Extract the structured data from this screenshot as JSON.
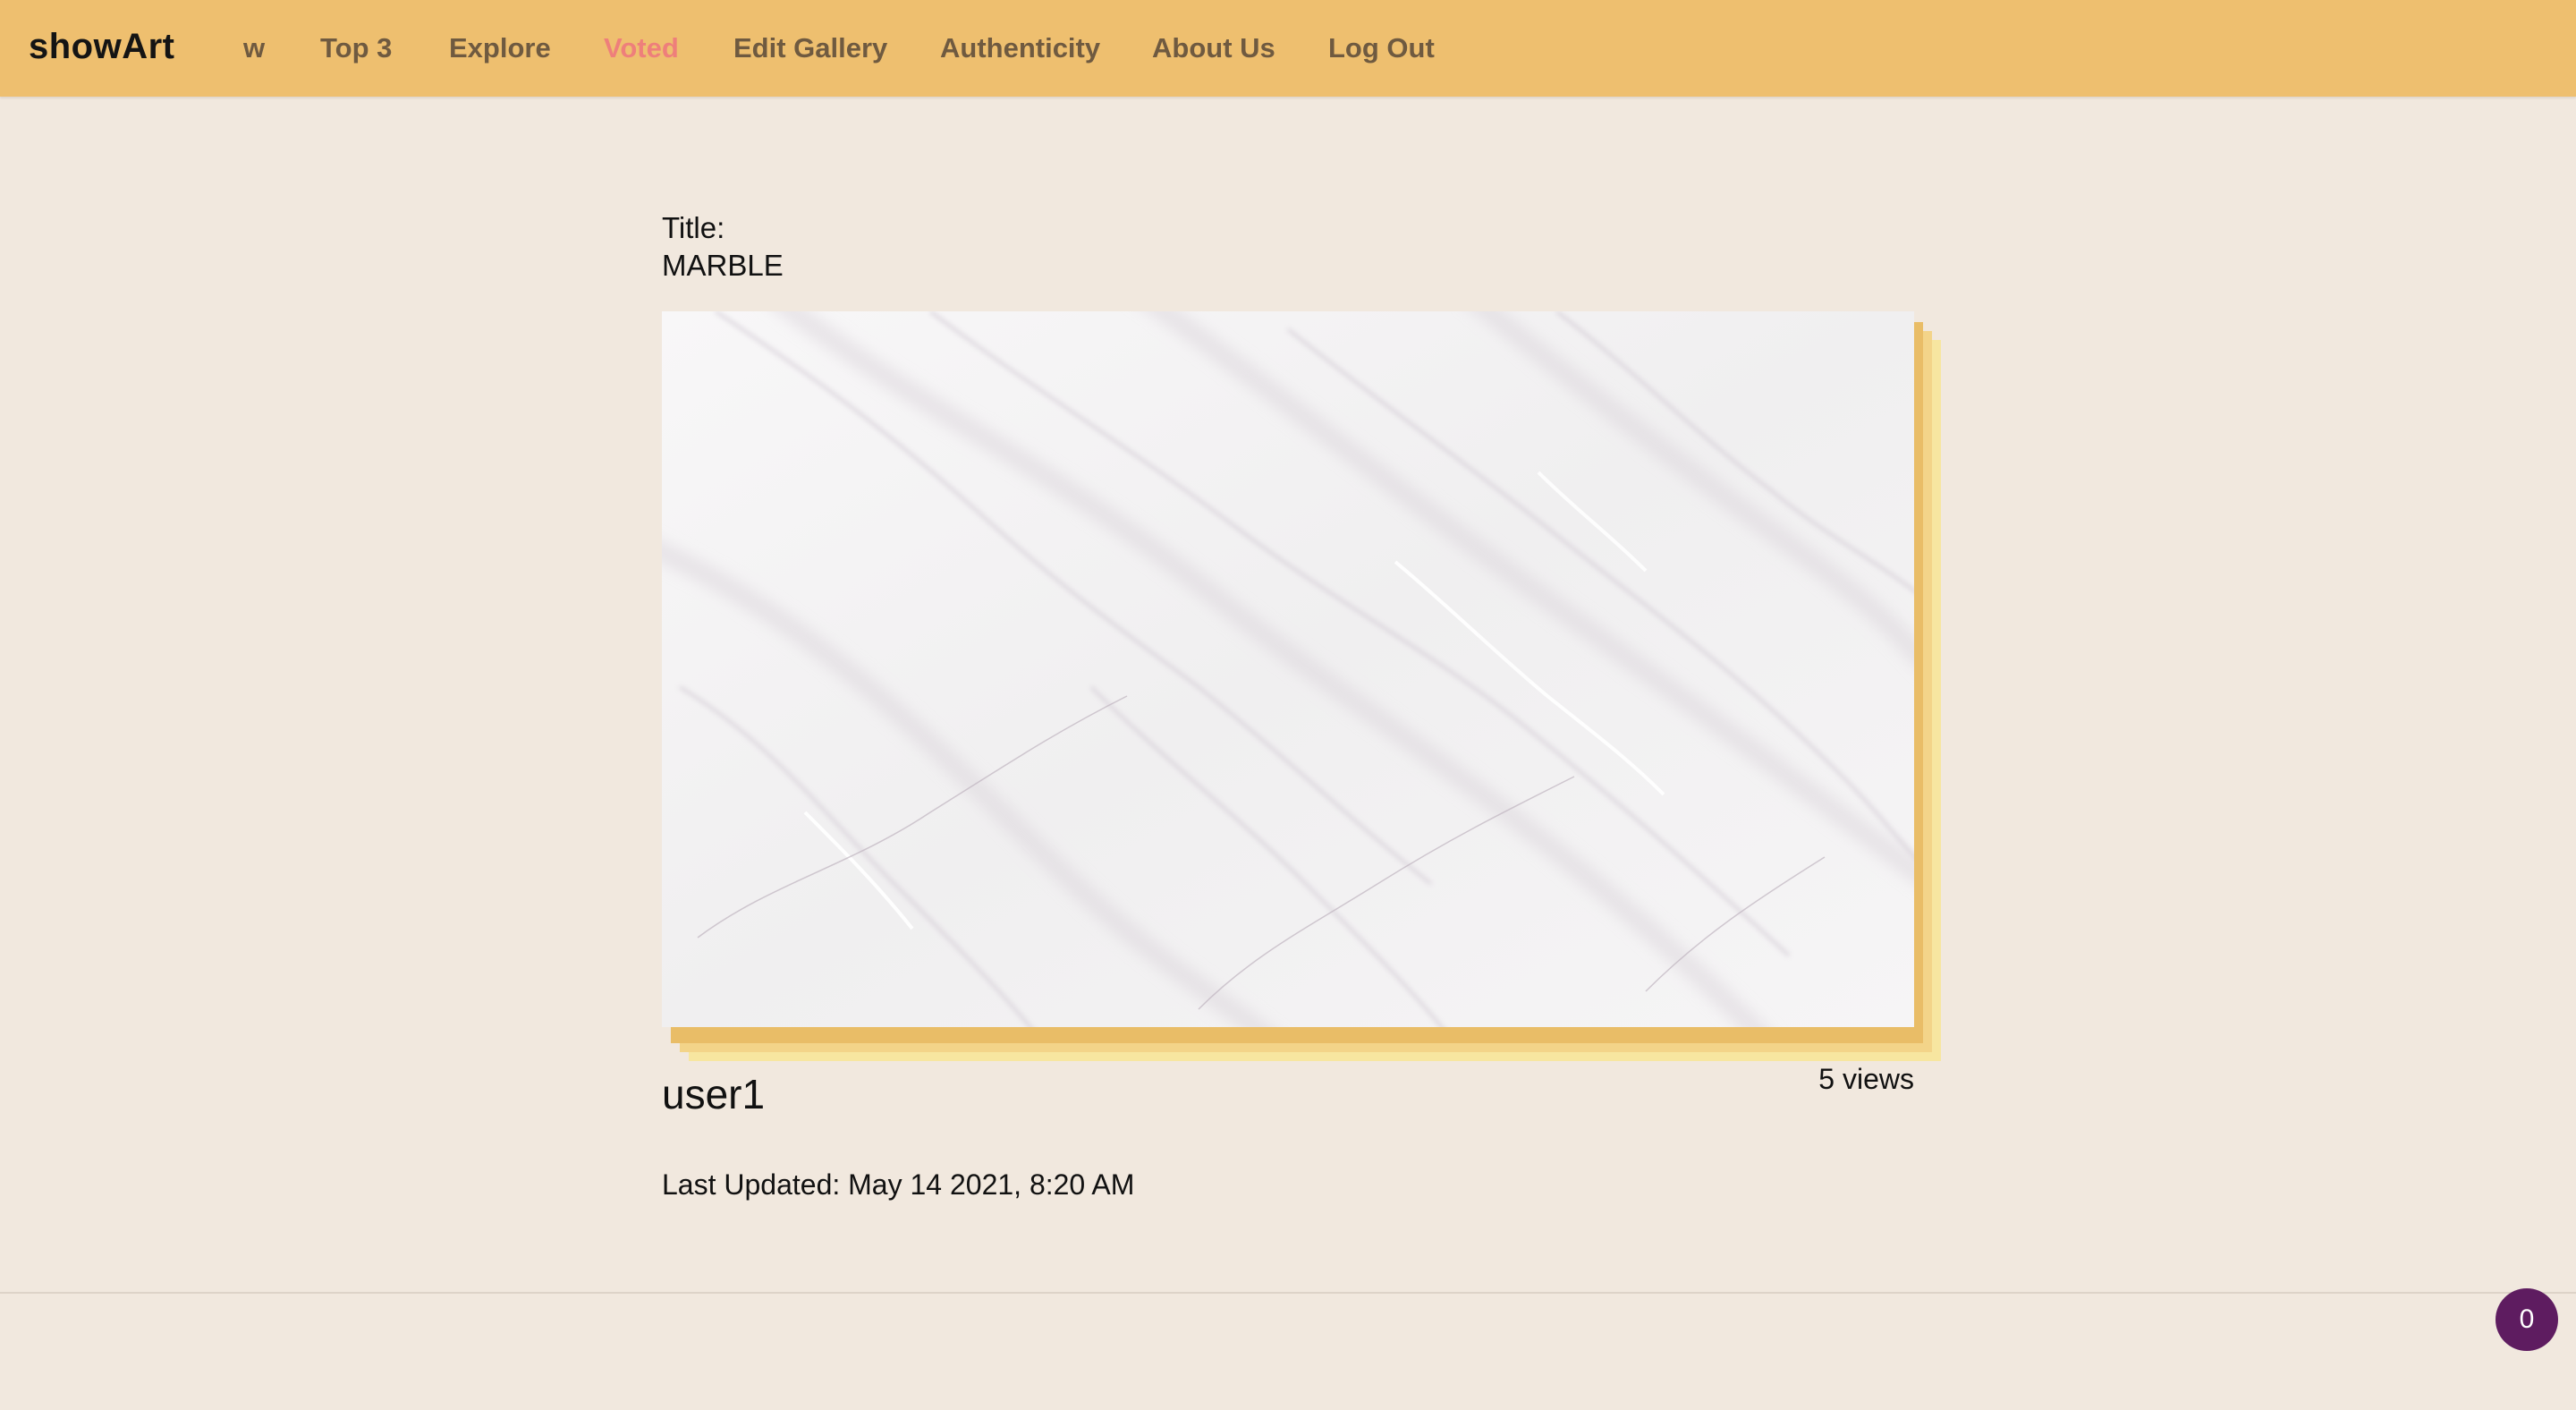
{
  "navbar": {
    "brand": "showArt",
    "links": [
      "w",
      "Top 3",
      "Explore",
      "Voted",
      "Edit Gallery",
      "Authenticity",
      "About Us",
      "Log Out"
    ],
    "active_link": "Voted",
    "background_color": "#eebf6f",
    "link_color": "#6f5a40",
    "active_color": "#ee7f7b"
  },
  "artwork": {
    "title_label": "Title:",
    "title": "MARBLE",
    "image_icon": "marble-texture-image",
    "author": "user1",
    "views": "5 views",
    "last_updated": "Last Updated: May 14 2021, 8:20 AM",
    "frame_colors": [
      "#e9bd67",
      "#f3d489",
      "#f7e6a0"
    ]
  },
  "vote_badge": {
    "count": "0",
    "color": "#5e1c60"
  },
  "page_background": "#f1e8de"
}
